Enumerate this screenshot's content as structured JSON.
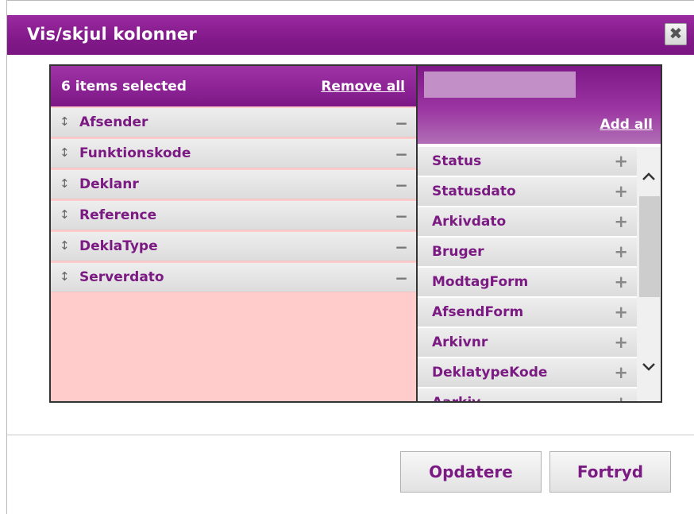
{
  "dialog": {
    "title": "Vis/skjul kolonner",
    "close_glyph": "✖"
  },
  "selected": {
    "count_label": "6 items selected",
    "remove_all_label": "Remove all",
    "items": [
      {
        "label": "Afsender"
      },
      {
        "label": "Funktionskode"
      },
      {
        "label": "Deklanr"
      },
      {
        "label": "Reference"
      },
      {
        "label": "DeklaType"
      },
      {
        "label": "Serverdato"
      }
    ],
    "drag_glyph": "↕",
    "remove_glyph": "−"
  },
  "available": {
    "search_value": "",
    "add_all_label": "Add all",
    "add_glyph": "+",
    "items": [
      {
        "label": "Status"
      },
      {
        "label": "Statusdato"
      },
      {
        "label": "Arkivdato"
      },
      {
        "label": "Bruger"
      },
      {
        "label": "ModtagForm"
      },
      {
        "label": "AfsendForm"
      },
      {
        "label": "Arkivnr"
      },
      {
        "label": "DeklatypeKode"
      },
      {
        "label": "Aarkiv"
      }
    ]
  },
  "buttons": {
    "update_label": "Opdatere",
    "cancel_label": "Fortryd"
  },
  "colors": {
    "header_purple": "#82198a",
    "item_text": "#7b1a82",
    "selected_bg": "#ffcccb",
    "search_bg": "#c28fc6"
  }
}
